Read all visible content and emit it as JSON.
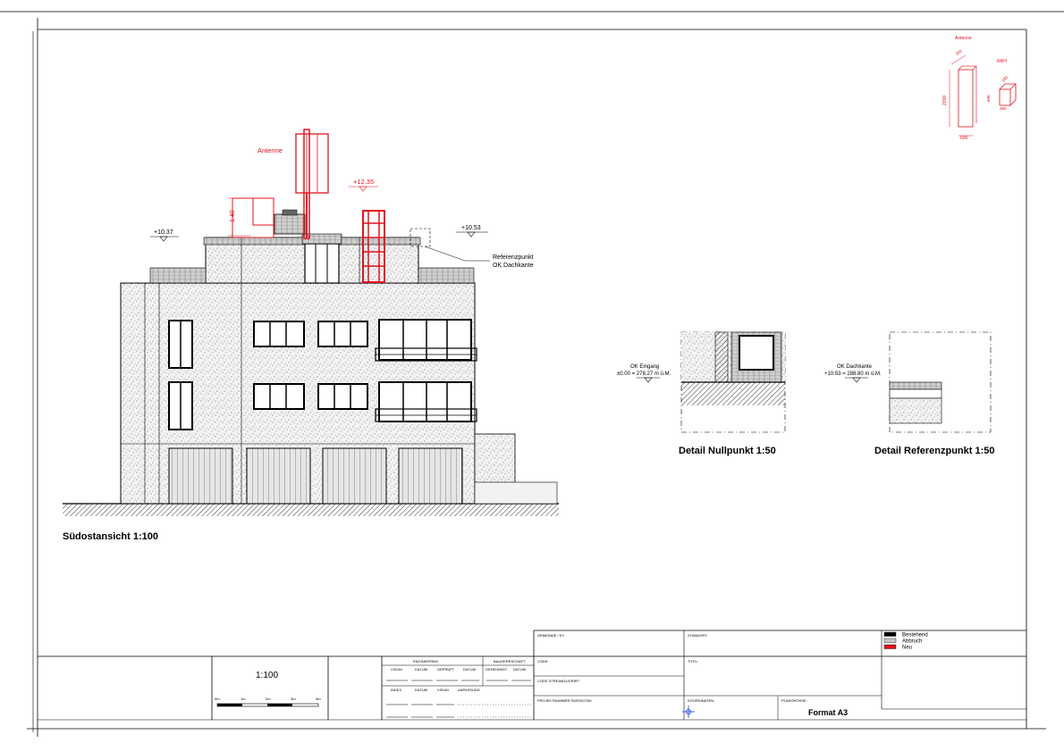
{
  "drawing": {
    "main_view_title": "Südostansicht 1:100",
    "detail_1_title": "Detail Nullpunkt 1:50",
    "detail_2_title": "Detail Referenzpunkt 1:50"
  },
  "labels": {
    "antenna": "Antenne",
    "level_left": "+10.37",
    "level_right": "+10.53",
    "level_top": "+12.35",
    "dim_140": "1.40",
    "ref_line1": "Referenzpunkt",
    "ref_line2": "OK Dachkante",
    "ok_entrance_line1": "OK Eingang",
    "ok_entrance_line2": "±0.00 = 278.27 m ü.M.",
    "ok_roof_line1": "OK Dachkante",
    "ok_roof_line2": "+10.53 = 288.80 m ü.M."
  },
  "equipment_key": {
    "antenna": "Antenne",
    "rrh": "RRH",
    "dim_height": "2200",
    "dim_width": "600",
    "dim_depth": "200",
    "rrh_h": "690",
    "rrh_w": "390",
    "rrh_d": "180"
  },
  "title_block": {
    "scale": "1:100",
    "scalebar_ticks": [
      "0m",
      "1m",
      "2m",
      "3m",
      "4m"
    ],
    "engineering": "ENGINEERING",
    "bauherrschaft": "BAUHERRSCHAFT",
    "visum": "VISUM",
    "datum": "DATUM",
    "geprueft": "GEPRÜFT",
    "datum2": "DATUM",
    "genehmigt": "GENEHMIGT",
    "datum3": "DATUM",
    "index": "INDEX",
    "datum4": "DATUM",
    "visum2": "VISUM",
    "anpassung": "ANPASSUNG",
    "gemeinde": "GEMEINDE / KT:",
    "standort": "STANDORT:",
    "code": "CODE:",
    "titel": "TITEL:",
    "code_streamzugriff": "CODE STREAMZUGRIFF:",
    "projektnummer": "PROJEKTNUMMER SWISSCOM:",
    "koordinaten": "KOORDINATEN:",
    "plangroesse": "PLANGRÖSSE:",
    "format": "Format A3"
  },
  "legend": [
    {
      "label": "Bestehend",
      "color": "#000000"
    },
    {
      "label": "Abbruch",
      "color": "#c8c8c8"
    },
    {
      "label": "Neu",
      "color": "#e0141e"
    }
  ],
  "colors": {
    "new": "#e0141e",
    "existing": "#000000",
    "demolish": "#c8c8c8"
  }
}
